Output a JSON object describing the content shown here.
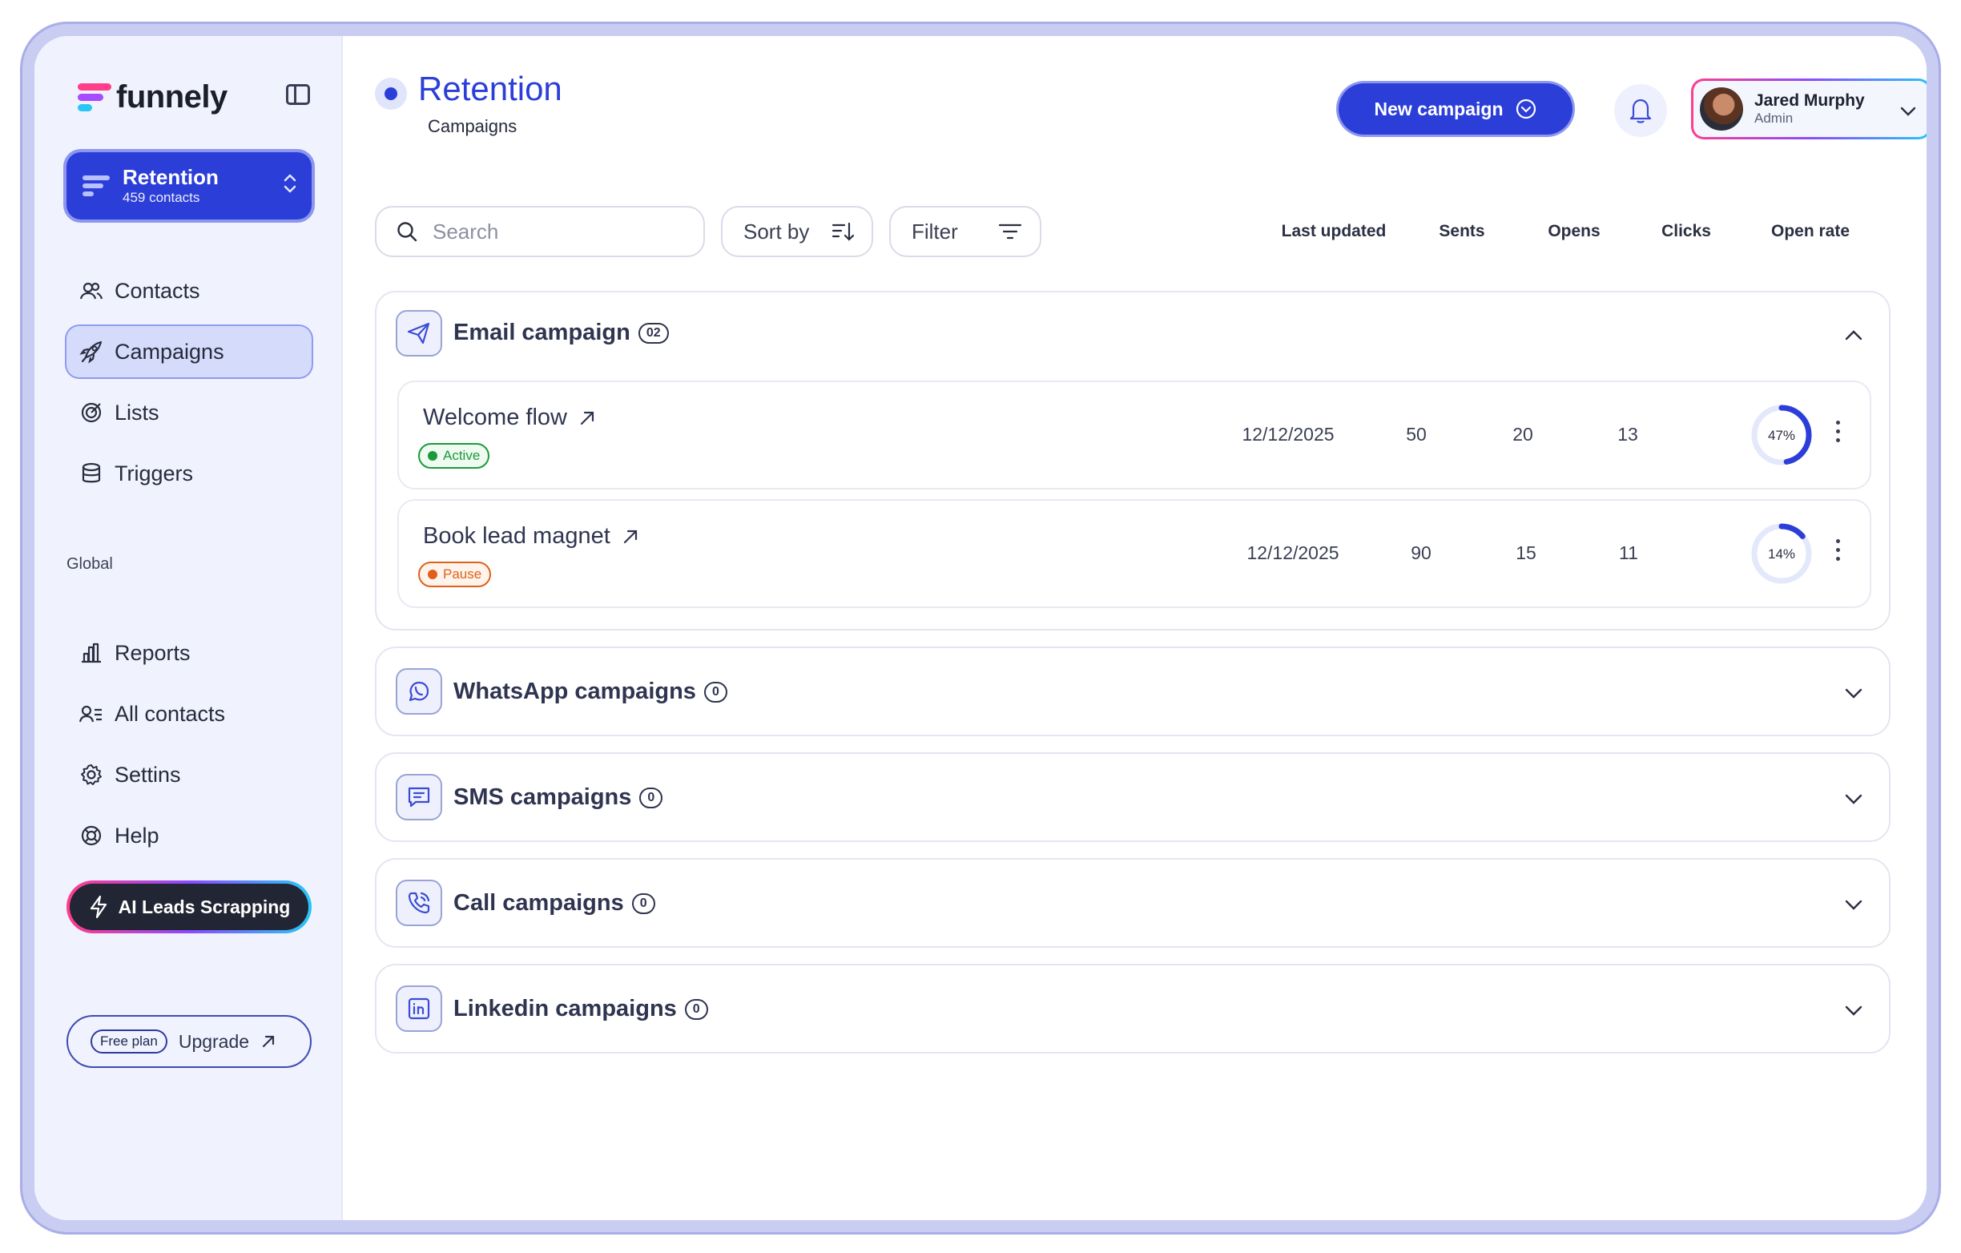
{
  "brand": {
    "name": "funnely"
  },
  "workspace": {
    "title": "Retention",
    "subtitle": "459 contacts"
  },
  "nav": [
    {
      "label": "Contacts",
      "icon": "users-icon"
    },
    {
      "label": "Campaigns",
      "icon": "rocket-icon",
      "active": true
    },
    {
      "label": "Lists",
      "icon": "target-icon"
    },
    {
      "label": "Triggers",
      "icon": "database-icon"
    }
  ],
  "global_label": "Global",
  "global_nav": [
    {
      "label": "Reports",
      "icon": "bar-chart-icon"
    },
    {
      "label": "All contacts",
      "icon": "contacts-list-icon"
    },
    {
      "label": "Settins",
      "icon": "gear-icon"
    },
    {
      "label": "Help",
      "icon": "lifebuoy-icon"
    }
  ],
  "ai_button": "AI Leads Scrapping",
  "plan": {
    "badge": "Free plan",
    "upgrade": "Upgrade"
  },
  "header": {
    "title": "Retention",
    "subtitle": "Campaigns",
    "new_campaign": "New campaign"
  },
  "user": {
    "name": "Jared Murphy",
    "role": "Admin"
  },
  "toolbar": {
    "search_placeholder": "Search",
    "sort_label": "Sort by",
    "filter_label": "Filter"
  },
  "columns": [
    "Last updated",
    "Sents",
    "Opens",
    "Clicks",
    "Open rate"
  ],
  "groups": [
    {
      "title": "Email campaign",
      "count": "02",
      "icon": "send-icon",
      "expanded": true,
      "rows": [
        {
          "name": "Welcome flow",
          "status": "Active",
          "status_color": "#1a9a3b",
          "last_updated": "12/12/2025",
          "sents": "50",
          "opens": "20",
          "clicks": "13",
          "open_rate": "47%",
          "open_rate_value": 0.47
        },
        {
          "name": "Book lead magnet",
          "status": "Pause",
          "status_color": "#e0601b",
          "last_updated": "12/12/2025",
          "sents": "90",
          "opens": "15",
          "clicks": "11",
          "open_rate": "14%",
          "open_rate_value": 0.14
        }
      ]
    },
    {
      "title": "WhatsApp campaigns",
      "count": "0",
      "icon": "whatsapp-icon",
      "expanded": false
    },
    {
      "title": "SMS campaigns",
      "count": "0",
      "icon": "message-icon",
      "expanded": false
    },
    {
      "title": "Call campaigns",
      "count": "0",
      "icon": "phone-icon",
      "expanded": false
    },
    {
      "title": "Linkedin campaigns",
      "count": "0",
      "icon": "linkedin-icon",
      "expanded": false
    }
  ],
  "colors": {
    "accent": "#2b3ed8",
    "active_green": "#1a9a3b",
    "pause_orange": "#e0601b"
  }
}
